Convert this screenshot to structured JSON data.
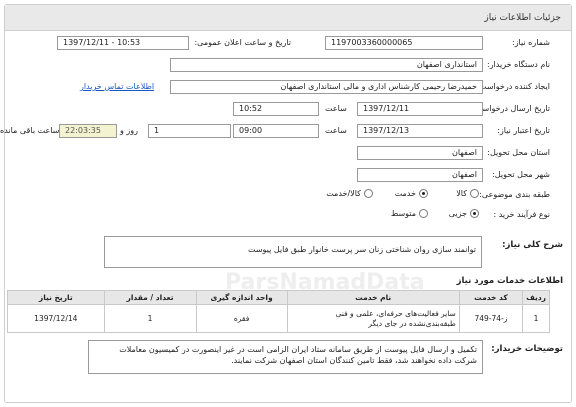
{
  "header": {
    "title": "جزئیات اطلاعات نیاز"
  },
  "fields": {
    "need_number_label": "شماره نیاز:",
    "need_number": "1197003360000065",
    "announce_label": "تاریخ و ساعت اعلان عمومی:",
    "announce_value": "1397/12/11 - 10:53",
    "buyer_label": "نام دستگاه خریدار:",
    "buyer_value": "استانداری اصفهان",
    "creator_label": "ایجاد کننده درخواست:",
    "creator_value": "حمیدرضا رحیمی کارشناس اداری و مالی استانداری اصفهان",
    "contact_link": "اطلاعات تماس خریدار",
    "send_date_label": "تاریخ ارسال درخواست:",
    "send_date": "1397/12/11",
    "send_time_label": "ساعت",
    "send_time": "10:52",
    "deadline_label": "تاریخ اعتبار نیاز:",
    "deadline_date": "1397/12/13",
    "deadline_time_label": "ساعت",
    "deadline_time": "09:00",
    "days_value": "1",
    "days_label": "روز و",
    "remaining_time": "22:03:35",
    "remaining_label": "ساعت باقی مانده",
    "province_label": "استان محل تحویل:",
    "province_value": "اصفهان",
    "city_label": "شهر محل تحویل:",
    "city_value": "اصفهان",
    "category_label": "طبقه بندی موضوعی:",
    "category_options": [
      "کالا",
      "خدمت",
      "کالا/خدمت"
    ],
    "process_label": "نوع فرآیند خرید :",
    "process_options": [
      "جزیی",
      "متوسط"
    ]
  },
  "summary": {
    "label": "شرح کلی نیاز:",
    "value": "توانمند سازی روان شناختی زنان  سر پرست خانوار طبق فایل پیوست"
  },
  "services": {
    "title": "اطلاعات خدمات مورد نیاز",
    "columns": [
      "ردیف",
      "کد خدمت",
      "نام خدمت",
      "واحد اندازه گیری",
      "تعداد / مقدار",
      "تاریخ نیاز"
    ],
    "rows": [
      {
        "row": "1",
        "code": "ز-74-749",
        "name": "سایر فعالیت‌های حرفه‌ای، علمی و فنی طبقه‌بندی‌نشده در جای دیگر",
        "unit": "فقره",
        "qty": "1",
        "date": "1397/12/14"
      }
    ]
  },
  "buyer_notes": {
    "label": "توضیحات خریدار:",
    "text": "تکمیل و ارسال فایل پیوست از طریق سامانه ستاد ایران الزامی است در غیر اینصورت در کمیسیون معاملات شرکت داده نخواهند شد، فقط تامین کنندگان استان اصفهان شرکت نمایند."
  },
  "colors": {
    "header_bg": "#e9e9e9",
    "link": "#1a56c4",
    "timer_bg": "#f3f3cf"
  }
}
